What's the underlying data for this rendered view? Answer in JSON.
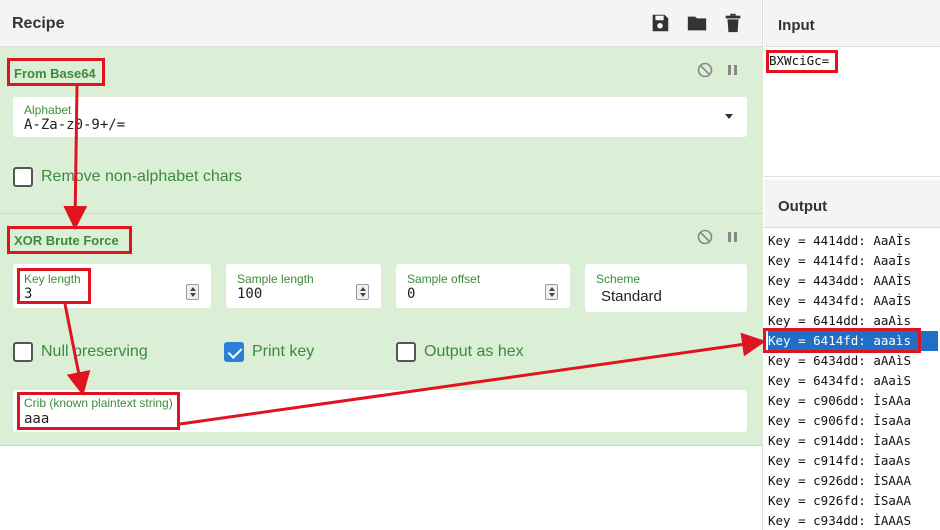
{
  "recipe": {
    "title": "Recipe"
  },
  "ops": {
    "from_base64": {
      "title": "From Base64",
      "alphabet_label": "Alphabet",
      "alphabet_value": "A-Za-z0-9+/=",
      "remove_label": "Remove non-alphabet chars"
    },
    "xor": {
      "title": "XOR Brute Force",
      "key_length_label": "Key length",
      "key_length_value": "3",
      "sample_length_label": "Sample length",
      "sample_length_value": "100",
      "sample_offset_label": "Sample offset",
      "sample_offset_value": "0",
      "scheme_label": "Scheme",
      "scheme_value": "Standard",
      "null_label": "Null preserving",
      "print_key_label": "Print key",
      "hex_label": "Output as hex",
      "crib_label": "Crib (known plaintext string)",
      "crib_value": "aaa"
    }
  },
  "input": {
    "title": "Input",
    "text": "BXWciGc="
  },
  "output": {
    "title": "Output",
    "lines": [
      "Key = 4414dd: AaAÌs",
      "Key = 4414fd: AaaÌs",
      "Key = 4434dd: AAAÌS",
      "Key = 4434fd: AAaÌS",
      "Key = 6414dd: aaAìs",
      "Key = 6414fd: aaaìs",
      "Key = 6434dd: aAAìS",
      "Key = 6434fd: aAaìS",
      "Key = c906dd: ÌsAAa",
      "Key = c906fd: ÌsaAa",
      "Key = c914dd: ÌaAAs",
      "Key = c914fd: ÌaaAs",
      "Key = c926dd: ÌSAAA",
      "Key = c926fd: ÌSaAA",
      "Key = c934dd: ÌAAAS"
    ],
    "selected_index": 5
  }
}
